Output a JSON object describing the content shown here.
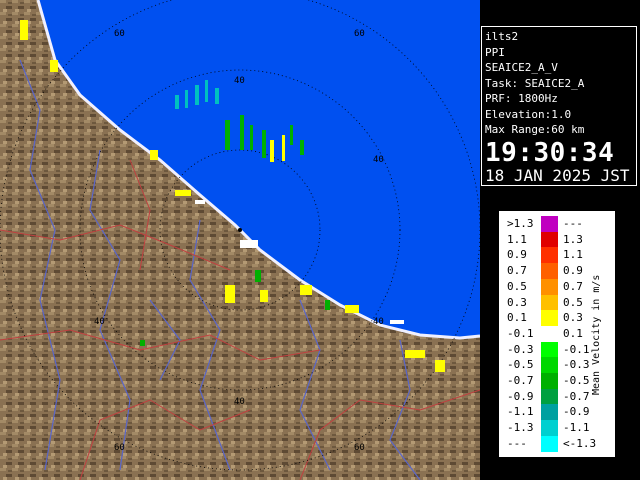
{
  "info": {
    "site": "ilts2",
    "mode": "PPI",
    "product": "SEAICE2_A_V",
    "task": "Task: SEAICE2_A",
    "prf": "PRF: 1800Hz",
    "elevation": "Elevation:1.0",
    "max_range": "Max Range:60 km",
    "time": "19:30:34",
    "date": "18 JAN 2025 JST"
  },
  "ring_labels": [
    {
      "text": "60"
    },
    {
      "text": "60"
    },
    {
      "text": "40"
    },
    {
      "text": "40"
    },
    {
      "text": "40"
    },
    {
      "text": "40"
    },
    {
      "text": "40"
    },
    {
      "text": "60"
    },
    {
      "text": "60"
    }
  ],
  "legend": {
    "title": "Mean Velocity in m/s",
    "rows": [
      {
        "lo": ">1.3",
        "hi": "---",
        "color": "#c000c0"
      },
      {
        "lo": "1.1",
        "hi": "1.3",
        "color": "#e00000"
      },
      {
        "lo": "0.9",
        "hi": "1.1",
        "color": "#ff3000"
      },
      {
        "lo": "0.7",
        "hi": "0.9",
        "color": "#ff6000"
      },
      {
        "lo": "0.5",
        "hi": "0.7",
        "color": "#ff9000"
      },
      {
        "lo": "0.3",
        "hi": "0.5",
        "color": "#ffc000"
      },
      {
        "lo": "0.1",
        "hi": "0.3",
        "color": "#ffff00"
      },
      {
        "lo": "-0.1",
        "hi": "0.1",
        "color": "#ffffff"
      },
      {
        "lo": "-0.3",
        "hi": "-0.1",
        "color": "#00ff00"
      },
      {
        "lo": "-0.5",
        "hi": "-0.3",
        "color": "#00d800"
      },
      {
        "lo": "-0.7",
        "hi": "-0.5",
        "color": "#00b000"
      },
      {
        "lo": "-0.9",
        "hi": "-0.7",
        "color": "#00a040"
      },
      {
        "lo": "-1.1",
        "hi": "-0.9",
        "color": "#00a0a0"
      },
      {
        "lo": "-1.3",
        "hi": "-1.1",
        "color": "#00d0d0"
      },
      {
        "lo": "---",
        "hi": "<-1.3",
        "color": "#00ffff"
      }
    ]
  },
  "colors": {
    "sea": "#0050f0",
    "land": "#8a7152",
    "coast_strip": "#f0f0ff",
    "river": "#5a66c8",
    "boundary": "#c04040",
    "range_ring": "#000000"
  }
}
